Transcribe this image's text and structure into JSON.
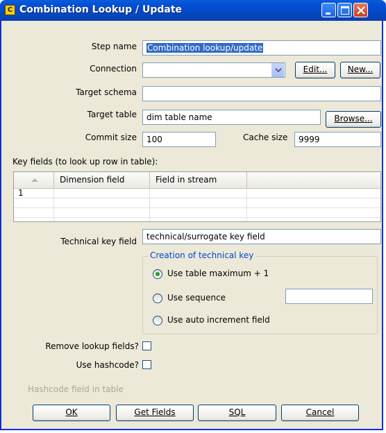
{
  "window": {
    "title": "Combination Lookup / Update",
    "icon_letter": "C"
  },
  "form": {
    "step_name_label": "Step name",
    "step_name_value": "Combination lookup/update",
    "connection_label": "Connection",
    "connection_value": "",
    "edit_label": "Edit...",
    "new_label": "New...",
    "target_schema_label": "Target schema",
    "target_schema_value": "",
    "target_table_label": "Target table",
    "target_table_value": "dim table name",
    "browse_label": "Browse...",
    "commit_size_label": "Commit size",
    "commit_size_value": "100",
    "cache_size_label": "Cache size",
    "cache_size_value": "9999"
  },
  "key_fields": {
    "label": "Key fields (to look up row in table):",
    "columns": [
      "Dimension field",
      "Field in stream"
    ],
    "rows": [
      {
        "num": "1",
        "dimension_field": "",
        "field_in_stream": ""
      }
    ]
  },
  "technical_key": {
    "label": "Technical key field",
    "value": "technical/surrogate key field",
    "group_title": "Creation of technical key",
    "options": [
      {
        "label": "Use table maximum + 1",
        "selected": true
      },
      {
        "label": "Use sequence",
        "selected": false
      },
      {
        "label": "Use auto increment field",
        "selected": false
      }
    ],
    "sequence_value": ""
  },
  "options": {
    "remove_lookup_label": "Remove lookup fields?",
    "remove_lookup_checked": false,
    "use_hashcode_label": "Use hashcode?",
    "use_hashcode_checked": false,
    "hashcode_field_label": "Hashcode field in table"
  },
  "buttons": {
    "ok": "OK",
    "get_fields": "Get Fields",
    "sql": "SQL",
    "cancel": "Cancel"
  },
  "colors": {
    "title_bar": "#0450d8",
    "window_bg": "#ece9d8",
    "group_title": "#0046d5",
    "radio_dot": "#21a121"
  }
}
